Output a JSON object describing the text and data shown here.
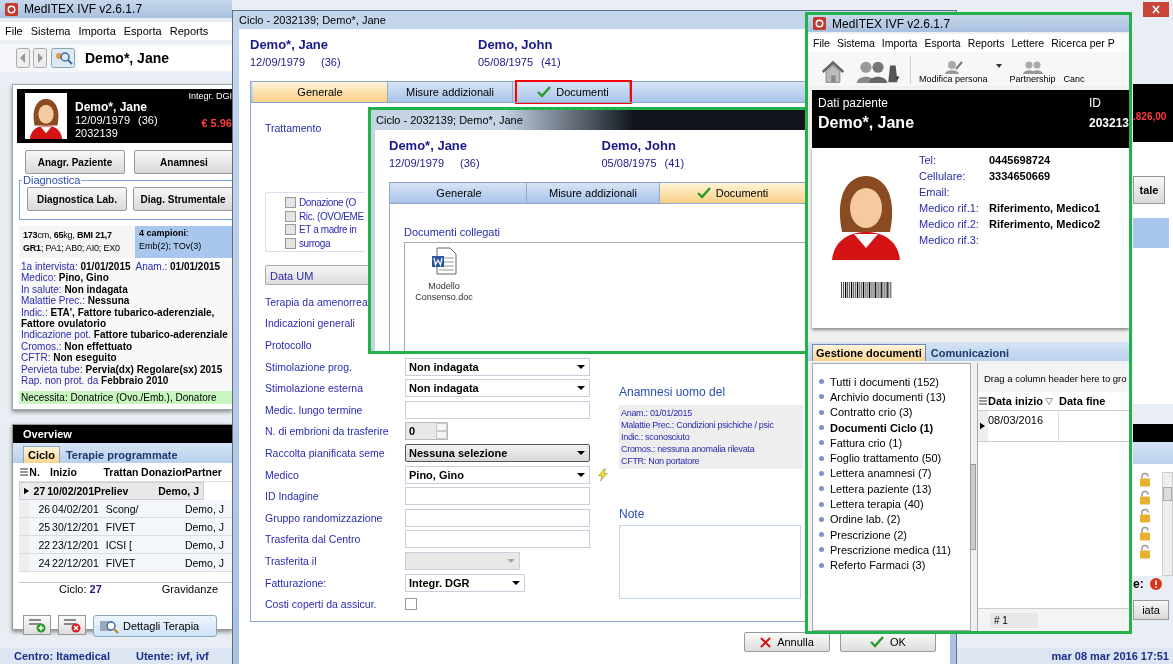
{
  "main_window": {
    "title": "MedITEX IVF v2.6.1.7",
    "menu": [
      "File",
      "Sistema",
      "Importa",
      "Esporta",
      "Reports"
    ],
    "patient_field": "Demo*, Jane",
    "patient_card": {
      "name": "Demo*, Jane",
      "birth": "12/09/1979",
      "age": "(36)",
      "id": "2032139",
      "billing": "Integr. DGI",
      "balance": "€ 5.96"
    },
    "buttons": [
      "Anagr. Paziente",
      "Anamnesi"
    ],
    "diagnostica": {
      "title": "Diagnostica",
      "buttons": [
        "Diagnostica Lab.",
        "Diag. Strumentale"
      ]
    },
    "stats": [
      "**173**cm, **65**kg, **BMI 21,7**",
      "**GR1**; PA1; AB0; AI0; EX0"
    ],
    "samples": [
      "**4 campioni**:",
      "Emb(2); TOv(3)"
    ],
    "info": [
      {
        "label": "1a intervista:",
        "value": "01/01/2015",
        "label_2": "Anam.:",
        "value_2": "01/01/2015"
      },
      {
        "label": "Medico:",
        "value": "Pino, Gino"
      },
      {
        "label": "In salute:",
        "value": "Non indagata"
      },
      {
        "label": "Malattie Prec.:",
        "value": "Nessuna"
      },
      {
        "label": "Indic.:",
        "value": "ETA', Fattore tubarico-aderenziale, Fattore ovulatorio"
      },
      {
        "label": "Indicazione pot.",
        "value": "Fattore tubarico-aderenziale"
      },
      {
        "label": "Cromos.:",
        "value": "Non effettuato"
      },
      {
        "label": "CFTR:",
        "value": "Non eseguito"
      },
      {
        "label": "Pervieta tube:",
        "value": "Pervia(dx) Regolare(sx) 2015"
      },
      {
        "label": "Rap. non prot. da",
        "value": "Febbraio 2010"
      }
    ],
    "necessita": {
      "label": "Necessita:",
      "value": "Donatrice (Ovo./Emb.), Donatore"
    },
    "overview": {
      "title": "Overview",
      "tabs": [
        {
          "label": "Ciclo",
          "selected": true
        },
        {
          "label": "Terapie programmate",
          "selected": false
        }
      ],
      "columns": [
        "N.",
        "Inizio",
        "Trattan",
        "Donazior",
        "Partner"
      ],
      "rows": [
        {
          "n": "27",
          "inizio": "10/02/201",
          "trattamento": "Preliev",
          "partner": "Demo, J",
          "selected": true
        },
        {
          "n": "26",
          "inizio": "04/02/201",
          "trattamento": "Scong/",
          "partner": "Demo, J",
          "selected": false
        },
        {
          "n": "25",
          "inizio": "30/12/201",
          "trattamento": "FIVET",
          "partner": "Demo, J",
          "selected": false
        },
        {
          "n": "22",
          "inizio": "23/12/201",
          "trattamento": "ICSI  [",
          "partner": "Demo, J",
          "selected": false
        },
        {
          "n": "24",
          "inizio": "22/12/201",
          "trattamento": "FIVET",
          "partner": "Demo, J",
          "selected": false
        }
      ],
      "footer_label": "Ciclo:",
      "footer_value": "27",
      "footer_right": "Gravidanze",
      "details_button": "Dettagli Terapia"
    },
    "status": {
      "centro": "Centro: Itamedical",
      "utente": "Utente: ivf, ivf",
      "datetime": "mar 08 mar 2016 17:51"
    },
    "right_strip": {
      "balance": ".826,00",
      "button": "tale",
      "alert_label": "e:",
      "button_2": "iata"
    }
  },
  "ciclo_window": {
    "title": "Ciclo - 2032139; Demo*, Jane",
    "woman": {
      "name": "Demo*, Jane",
      "birth": "12/09/1979",
      "age": "(36)"
    },
    "man": {
      "name": "Demo, John",
      "birth": "05/08/1975",
      "age": "(41)"
    },
    "tabs": [
      {
        "label": "Generale",
        "selected": true,
        "checked": false,
        "highlighted": false
      },
      {
        "label": "Misure addizionali",
        "selected": false,
        "checked": false,
        "highlighted": false
      },
      {
        "label": "Documenti",
        "selected": false,
        "checked": true,
        "highlighted": true
      }
    ],
    "trattamento": "Trattamento",
    "checkboxes": [
      {
        "label": "Donazione (O",
        "checked": false
      },
      {
        "label": "Ric. (OVO/EME",
        "checked": false
      },
      {
        "label": "ET a madre in",
        "checked": false
      },
      {
        "label": "surroga",
        "checked": false
      }
    ],
    "data_um": "Data UM",
    "fields": [
      {
        "label": "Terapia da amenorrea",
        "kind": "label"
      },
      {
        "label": "Indicazioni generali",
        "kind": "label"
      },
      {
        "label": "Protocollo",
        "kind": "label"
      },
      {
        "label": "Stimolazione prog.",
        "kind": "select",
        "value": "Non indagata"
      },
      {
        "label": "Stimolazione esterna",
        "kind": "select",
        "value": "Non indagata"
      },
      {
        "label": "Medic. lungo termine",
        "kind": "text"
      },
      {
        "label": "N. di embrioni da trasferire",
        "kind": "spinner",
        "value": "0"
      },
      {
        "label": "Raccolta pianificata seme",
        "kind": "button_select",
        "value": "Nessuna selezione"
      },
      {
        "label": "Medico",
        "kind": "warned_select",
        "value": "Pino, Gino"
      },
      {
        "label": "ID Indagine",
        "kind": "text"
      },
      {
        "label": "Gruppo randomizzazione",
        "kind": "text"
      },
      {
        "label": "Trasferita dal Centro",
        "kind": "text"
      },
      {
        "label": "Trasferita il",
        "kind": "disabled_select"
      },
      {
        "label": "Fatturazione:",
        "kind": "short_select",
        "value": "Integr. DGR"
      },
      {
        "label": "Costi coperti da assicur.",
        "kind": "checkbox",
        "checked": false
      }
    ],
    "anamnesi_title": "Anamnesi uomo del",
    "anamnesi": [
      "Anam.: 01/01/2015",
      "Malattie Prec.: Condizioni psichiche / psic",
      "Indic.: sconosciuto",
      "Cromos.: nessuna anomalia rilevata",
      "CFTR: Non portatore"
    ],
    "note_label": "Note",
    "cancel": "Annulla",
    "ok": "OK"
  },
  "inner_window": {
    "title": "Ciclo - 2032139; Demo*, Jane",
    "woman": {
      "name": "Demo*, Jane",
      "birth": "12/09/1979",
      "age": "(36)"
    },
    "man": {
      "name": "Demo, John",
      "birth": "05/08/1975",
      "age": "(41)"
    },
    "tabs": [
      {
        "label": "Generale",
        "selected": false,
        "checked": false
      },
      {
        "label": "Misure addizionali",
        "selected": false,
        "checked": false
      },
      {
        "label": "Documenti",
        "selected": true,
        "checked": true
      }
    ],
    "documents_label": "Documenti collegati",
    "files": [
      {
        "name": "Modello Consenso.doc"
      }
    ]
  },
  "right_window": {
    "title": "MedITEX IVF v2.6.1.7",
    "menu": [
      "File",
      "Sistema",
      "Importa",
      "Esporta",
      "Reports",
      "Lettere",
      "Ricerca per P"
    ],
    "toolbar": [
      "Modifica persona",
      "Partnership",
      "Canc"
    ],
    "header": {
      "label": "Dati paziente",
      "name": "Demo*, Jane",
      "id_label": "ID",
      "id": "203213"
    },
    "fields": [
      {
        "label": "Tel:",
        "value": "0445698724"
      },
      {
        "label": "Cellulare:",
        "value": "3334650669"
      },
      {
        "label": "Email:"
      },
      {
        "label": "Medico rif.1:",
        "value": "Riferimento, Medico1"
      },
      {
        "label": "Medico rif.2:",
        "value": "Riferimento, Medico2"
      },
      {
        "label": "Medico rif.3:"
      }
    ],
    "tabs": [
      {
        "label": "Gestione documenti",
        "selected": true
      },
      {
        "label": "Comunicazioni",
        "selected": false
      }
    ],
    "categories": [
      {
        "label": "Tutti i documenti (152)",
        "selected": false
      },
      {
        "label": "Archivio documenti (13)",
        "selected": false
      },
      {
        "label": "Contratto crio (3)",
        "selected": false
      },
      {
        "label": "Documenti Ciclo (1)",
        "selected": true
      },
      {
        "label": "Fattura crio (1)",
        "selected": false
      },
      {
        "label": "Foglio trattamento (50)",
        "selected": false
      },
      {
        "label": "Lettera anamnesi (7)",
        "selected": false
      },
      {
        "label": "Lettera paziente (13)",
        "selected": false
      },
      {
        "label": "Lettera terapia (40)",
        "selected": false
      },
      {
        "label": "Ordine lab. (2)",
        "selected": false
      },
      {
        "label": "Prescrizione (2)",
        "selected": false
      },
      {
        "label": "Prescrizione medica (11)",
        "selected": false
      },
      {
        "label": "Referto Farmaci (3)",
        "selected": false
      }
    ],
    "grid": {
      "hint": "Drag a column header here to gro",
      "columns": [
        "Data inizio",
        "Data fine"
      ],
      "rows": [
        {
          "data_inizio": "08/03/2016"
        }
      ],
      "footer": "# 1"
    }
  }
}
